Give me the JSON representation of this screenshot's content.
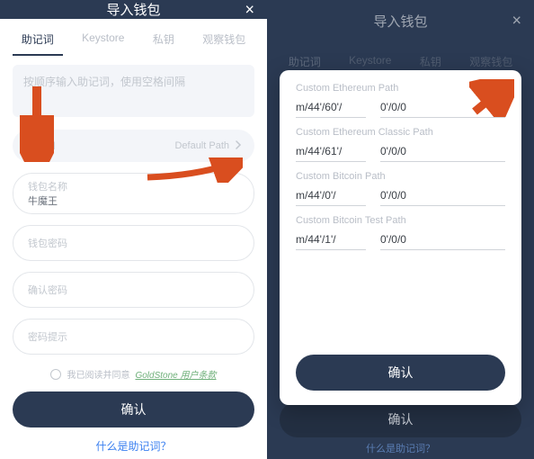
{
  "left": {
    "header": {
      "title": "导入钱包"
    },
    "tabs": [
      "助记词",
      "Keystore",
      "私钥",
      "观察钱包"
    ],
    "active_tab": 0,
    "mnemonic_placeholder": "按顺序输入助记词，使用空格间隔",
    "path": {
      "label": "PATH",
      "value": "Default Path"
    },
    "inputs": {
      "name_label": "钱包名称",
      "name_value": "牛魔王",
      "pwd_label": "钱包密码",
      "pwd2_label": "确认密码",
      "hint_label": "密码提示"
    },
    "terms": {
      "prefix": "我已阅读并同意",
      "link": "GoldStone 用户条款"
    },
    "confirm": "确认",
    "bottom_link": "什么是助记词？"
  },
  "right": {
    "header": {
      "title": "导入钱包"
    },
    "tabs": [
      "助记词",
      "Keystore",
      "私钥",
      "观察钱包"
    ],
    "modal": {
      "groups": [
        {
          "title": "Custom Ethereum Path",
          "p1": "m/44'/60'/",
          "p2": "0'/0/0"
        },
        {
          "title": "Custom Ethereum Classic Path",
          "p1": "m/44'/61'/",
          "p2": "0'/0/0"
        },
        {
          "title": "Custom Bitcoin Path",
          "p1": "m/44'/0'/",
          "p2": "0'/0/0"
        },
        {
          "title": "Custom Bitcoin Test Path",
          "p1": "m/44'/1'/",
          "p2": "0'/0/0"
        }
      ],
      "confirm": "确认"
    },
    "behind_confirm": "确认",
    "behind_link": "什么是助记词？"
  }
}
